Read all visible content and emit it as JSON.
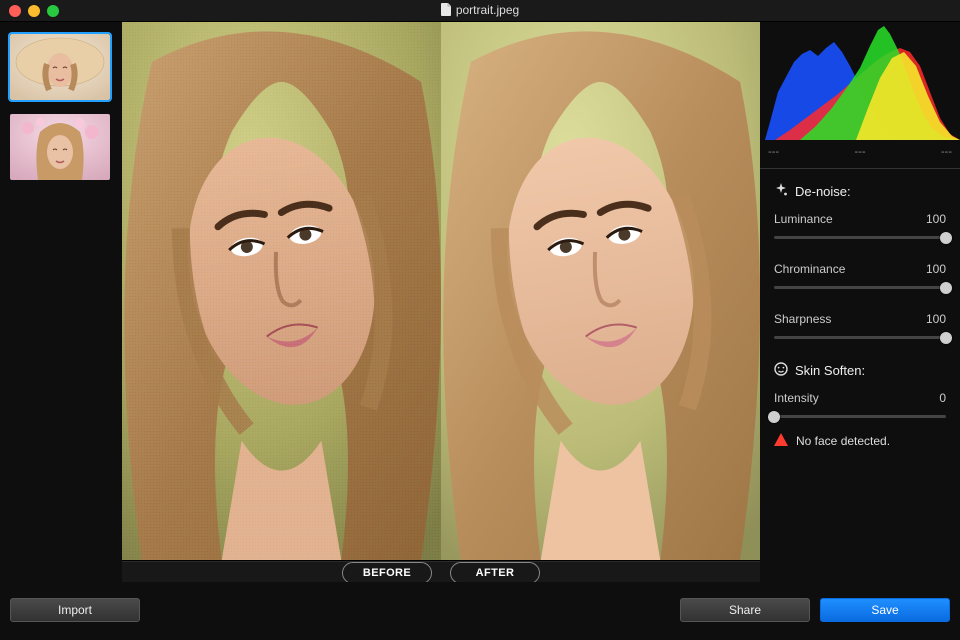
{
  "titlebar": {
    "filename": "portrait.jpeg"
  },
  "toggles": {
    "before": "BEFORE",
    "after": "AFTER"
  },
  "histogram": {
    "val_left": "---",
    "val_mid": "---",
    "val_right": "---"
  },
  "denoise": {
    "title": "De-noise:",
    "luminance": {
      "label": "Luminance",
      "value": "100",
      "pct": 100
    },
    "chrominance": {
      "label": "Chrominance",
      "value": "100",
      "pct": 100
    },
    "sharpness": {
      "label": "Sharpness",
      "value": "100",
      "pct": 100
    }
  },
  "skin": {
    "title": "Skin Soften:",
    "intensity": {
      "label": "Intensity",
      "value": "0",
      "pct": 0
    },
    "warning": "No face detected."
  },
  "footer": {
    "import": "Import",
    "share": "Share",
    "save": "Save"
  }
}
